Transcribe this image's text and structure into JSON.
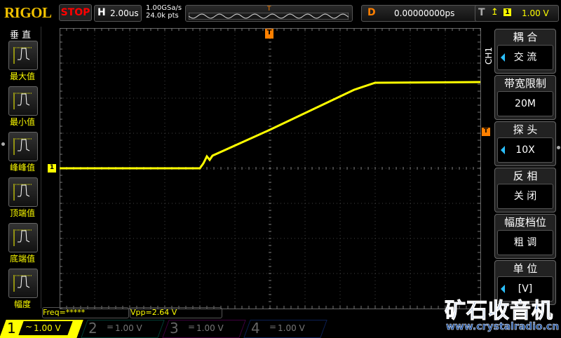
{
  "header": {
    "logo": "RIGOL",
    "run_state": "STOP",
    "h_label": "H",
    "timebase": "2.00us",
    "sample_rate": "1.00GSa/s",
    "memory_depth": "24.0k pts",
    "d_label": "D",
    "delay": "0.00000000ps",
    "t_label": "T",
    "trigger_source": "1",
    "trigger_level": "1.00 V"
  },
  "left_menu": {
    "title": "垂 直",
    "items": [
      {
        "label": "最大值"
      },
      {
        "label": "最小值"
      },
      {
        "label": "峰峰值"
      },
      {
        "label": "顶端值"
      },
      {
        "label": "底端值"
      },
      {
        "label": "幅度"
      }
    ]
  },
  "right_menu": {
    "channel": "CH1",
    "items": [
      {
        "title": "耦 合",
        "value": "交 流",
        "arrow": true
      },
      {
        "title": "带宽限制",
        "value": "20M",
        "arrow": false
      },
      {
        "title": "探 头",
        "value": "10X",
        "arrow": true
      },
      {
        "title": "反 相",
        "value": "关 闭",
        "arrow": false
      },
      {
        "title": "幅度档位",
        "value": "粗 调",
        "arrow": false
      },
      {
        "title": "单 位",
        "value": "[V]",
        "arrow": true
      }
    ]
  },
  "measurements": {
    "freq": "Freq=*****",
    "vpp": "Vpp=2.64 V"
  },
  "channels": [
    {
      "num": "1",
      "coupling": "~",
      "scale": "1.00 V",
      "color": "#ffff00"
    },
    {
      "num": "2",
      "coupling": "=",
      "scale": "1.00 V",
      "color": "#00c0a0"
    },
    {
      "num": "3",
      "coupling": "=",
      "scale": "1.00 V",
      "color": "#c000c0"
    },
    {
      "num": "4",
      "coupling": "=",
      "scale": "1.00 V",
      "color": "#2060ff"
    }
  ],
  "markers": {
    "trigger_pos": "T",
    "ch1_ground": "1",
    "trigger_level": "T"
  },
  "watermark": {
    "title": "矿石收音机",
    "url": "www.crystalradio.cn"
  },
  "colors": {
    "trace": "#ffff00",
    "trigger": "#ff8000",
    "accent": "#2bc0ff"
  }
}
